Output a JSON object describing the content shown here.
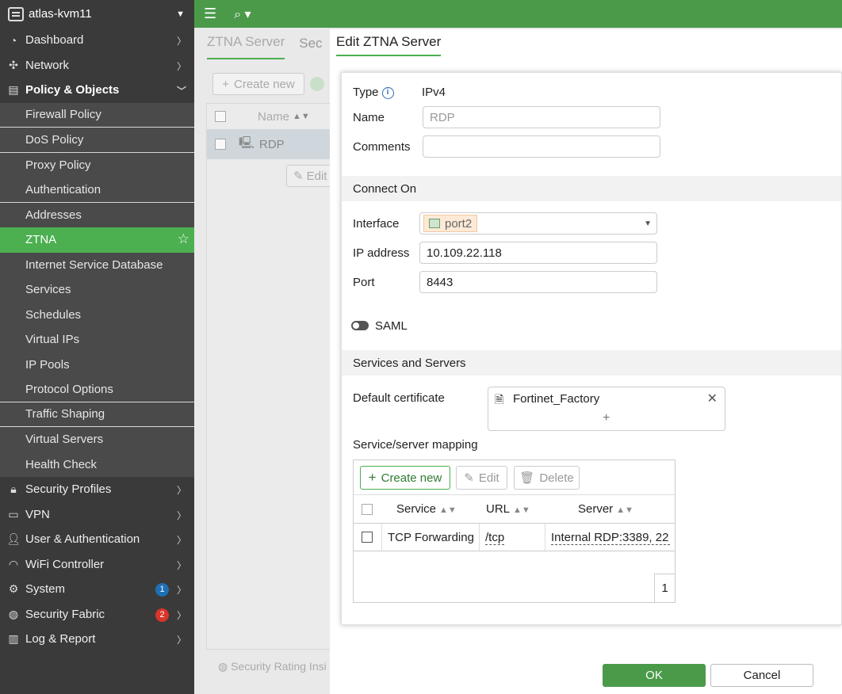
{
  "device": {
    "name": "atlas-kvm11"
  },
  "nav": [
    {
      "label": "Dashboard",
      "type": "top",
      "icon": "dashboard-icon",
      "glyph": "◔"
    },
    {
      "label": "Network",
      "type": "top",
      "icon": "network-icon",
      "glyph": "✣"
    },
    {
      "label": "Policy & Objects",
      "type": "top-open",
      "icon": "policy-icon",
      "glyph": "▤"
    },
    {
      "label": "Firewall Policy",
      "type": "sub",
      "sep": true
    },
    {
      "label": "DoS Policy",
      "type": "sub",
      "sep": true
    },
    {
      "label": "Proxy Policy",
      "type": "sub"
    },
    {
      "label": "Authentication",
      "type": "sub",
      "sep": true
    },
    {
      "label": "Addresses",
      "type": "sub"
    },
    {
      "label": "ZTNA",
      "type": "sub",
      "active": true
    },
    {
      "label": "Internet Service Database",
      "type": "sub"
    },
    {
      "label": "Services",
      "type": "sub"
    },
    {
      "label": "Schedules",
      "type": "sub"
    },
    {
      "label": "Virtual IPs",
      "type": "sub"
    },
    {
      "label": "IP Pools",
      "type": "sub"
    },
    {
      "label": "Protocol Options",
      "type": "sub",
      "sep": true
    },
    {
      "label": "Traffic Shaping",
      "type": "sub",
      "sep": true
    },
    {
      "label": "Virtual Servers",
      "type": "sub"
    },
    {
      "label": "Health Check",
      "type": "sub"
    },
    {
      "label": "Security Profiles",
      "type": "top",
      "icon": "lock-icon",
      "glyph": "🔒︎"
    },
    {
      "label": "VPN",
      "type": "top",
      "icon": "vpn-icon",
      "glyph": "▭"
    },
    {
      "label": "User & Authentication",
      "type": "top",
      "icon": "user-icon",
      "glyph": "👤︎"
    },
    {
      "label": "WiFi Controller",
      "type": "top",
      "icon": "wifi-icon",
      "glyph": "◠"
    },
    {
      "label": "System",
      "type": "top",
      "icon": "gear-icon",
      "glyph": "⚙",
      "badge": "1",
      "badge_color": "#1f6fb5"
    },
    {
      "label": "Security Fabric",
      "type": "top",
      "icon": "fabric-icon",
      "glyph": "◍",
      "badge": "2",
      "badge_color": "#d9342b"
    },
    {
      "label": "Log & Report",
      "type": "top",
      "icon": "report-icon",
      "glyph": "▥"
    }
  ],
  "background": {
    "tabs": [
      "ZTNA Server",
      "Sec"
    ],
    "create_new": "Create new",
    "col_name": "Name",
    "row_name": "RDP",
    "edit": "Edit",
    "footer": "Security Rating Insi"
  },
  "dialog": {
    "title": "Edit ZTNA Server",
    "type_label": "Type",
    "type_value": "IPv4",
    "name_label": "Name",
    "name_placeholder": "RDP",
    "comments_label": "Comments",
    "comments_value": "",
    "connect_on": "Connect On",
    "interface_label": "Interface",
    "interface_value": "port2",
    "ip_label": "IP address",
    "ip_value": "10.109.22.118",
    "port_label": "Port",
    "port_value": "8443",
    "saml_label": "SAML",
    "services_section": "Services and Servers",
    "default_cert_label": "Default certificate",
    "default_cert_value": "Fortinet_Factory",
    "mapping_label": "Service/server mapping",
    "mapping": {
      "create_new": "Create new",
      "edit": "Edit",
      "delete": "Delete",
      "col_service": "Service",
      "col_url": "URL",
      "col_server": "Server",
      "rows": [
        {
          "service": "TCP Forwarding",
          "url": "/tcp",
          "server": "Internal RDP:3389, 22"
        }
      ],
      "page": "1"
    },
    "ok": "OK",
    "cancel": "Cancel"
  },
  "colors": {
    "accent": "#4caf50",
    "topbar": "#4a9a4a",
    "sidebar": "#3a3a3a"
  }
}
